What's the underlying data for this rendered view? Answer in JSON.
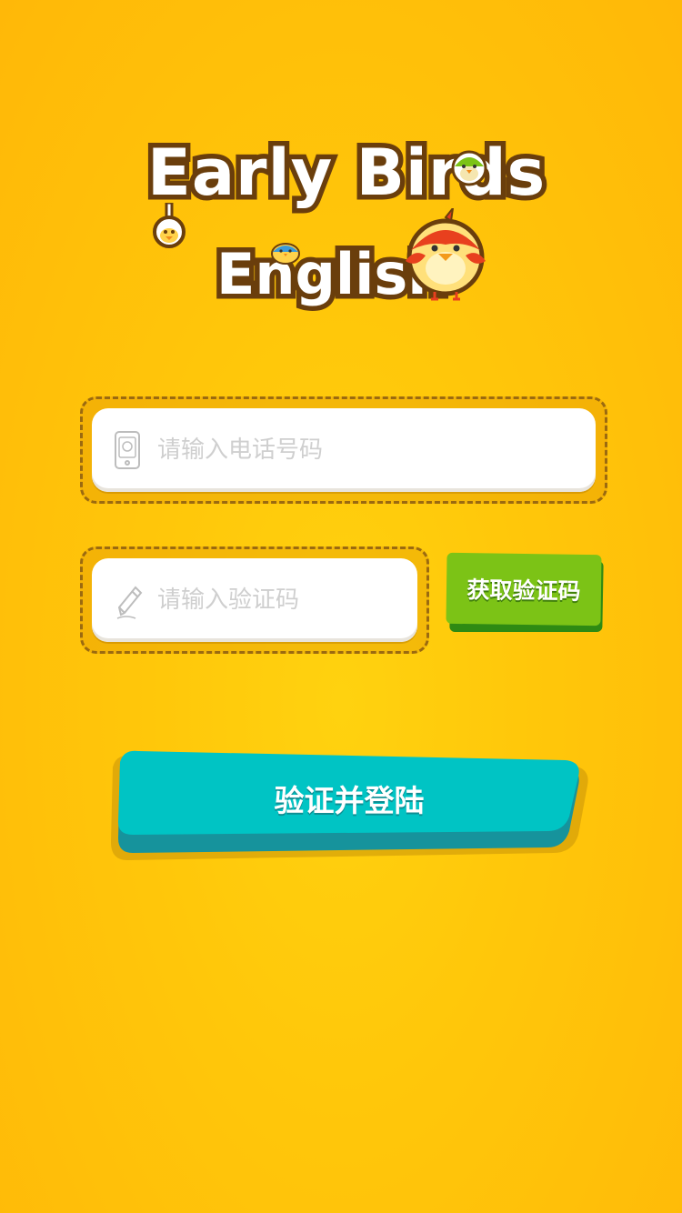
{
  "app": {
    "logo_line1": "Early Birds",
    "logo_line2": "English"
  },
  "form": {
    "phone_placeholder": "请输入电话号码",
    "phone_value": "",
    "code_placeholder": "请输入验证码",
    "code_value": "",
    "get_code_label": "获取验证码",
    "login_label": "验证并登陆"
  },
  "icons": {
    "phone": "phone-icon",
    "pencil": "pencil-icon"
  },
  "colors": {
    "background": "#ffc70a",
    "logo_outline": "#6a3e0c",
    "get_code_button": "#7cc316",
    "login_button": "#00c4c4",
    "input_frame": "#9b6a10"
  }
}
